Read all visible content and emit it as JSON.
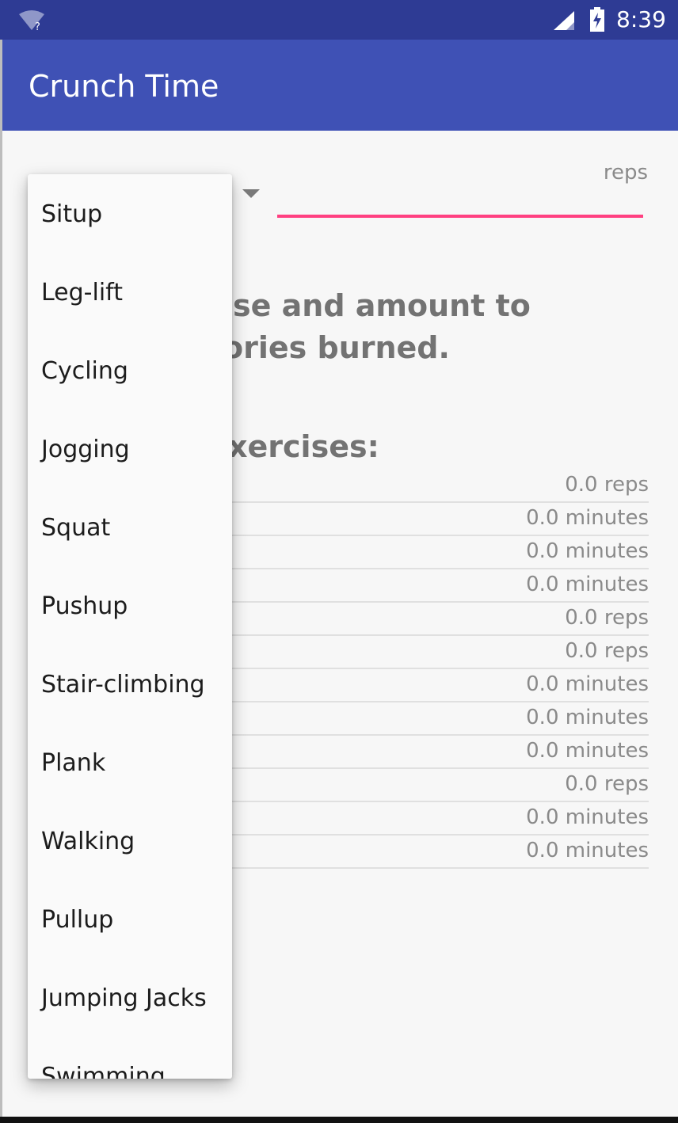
{
  "status_bar": {
    "time": "8:39",
    "wifi_unknown_mark": "?",
    "background_color": "#2e3b94"
  },
  "app_bar": {
    "title": "Crunch Time",
    "background_color": "#3f51b5"
  },
  "form": {
    "amount_hint": "reps",
    "accent_color": "#ff4081"
  },
  "instructions": {
    "line1": "ise and amount to",
    "line2": "ories burned."
  },
  "equivalent_header": "xercises:",
  "results": [
    {
      "name": "",
      "value": "0.0 reps"
    },
    {
      "name": "",
      "value": "0.0 minutes"
    },
    {
      "name": "",
      "value": "0.0 minutes"
    },
    {
      "name": "",
      "value": "0.0 minutes"
    },
    {
      "name": "",
      "value": "0.0 reps"
    },
    {
      "name": "",
      "value": "0.0 reps"
    },
    {
      "name": "",
      "value": "0.0 minutes"
    },
    {
      "name": "",
      "value": "0.0 minutes"
    },
    {
      "name": "",
      "value": "0.0 minutes"
    },
    {
      "name": "",
      "value": "0.0 reps"
    },
    {
      "name": "",
      "value": "0.0 minutes"
    },
    {
      "name": "",
      "value": "0.0 minutes"
    }
  ],
  "exercise_dropdown": {
    "options": [
      "Situp",
      "Leg-lift",
      "Cycling",
      "Jogging",
      "Squat",
      "Pushup",
      "Stair-climbing",
      "Plank",
      "Walking",
      "Pullup",
      "Jumping Jacks",
      "Swimming"
    ]
  },
  "icons": {
    "wifi": "wifi-unknown-icon",
    "signal": "cell-signal-icon",
    "battery": "battery-charging-icon",
    "spinner_arrow": "dropdown-triangle-icon"
  }
}
